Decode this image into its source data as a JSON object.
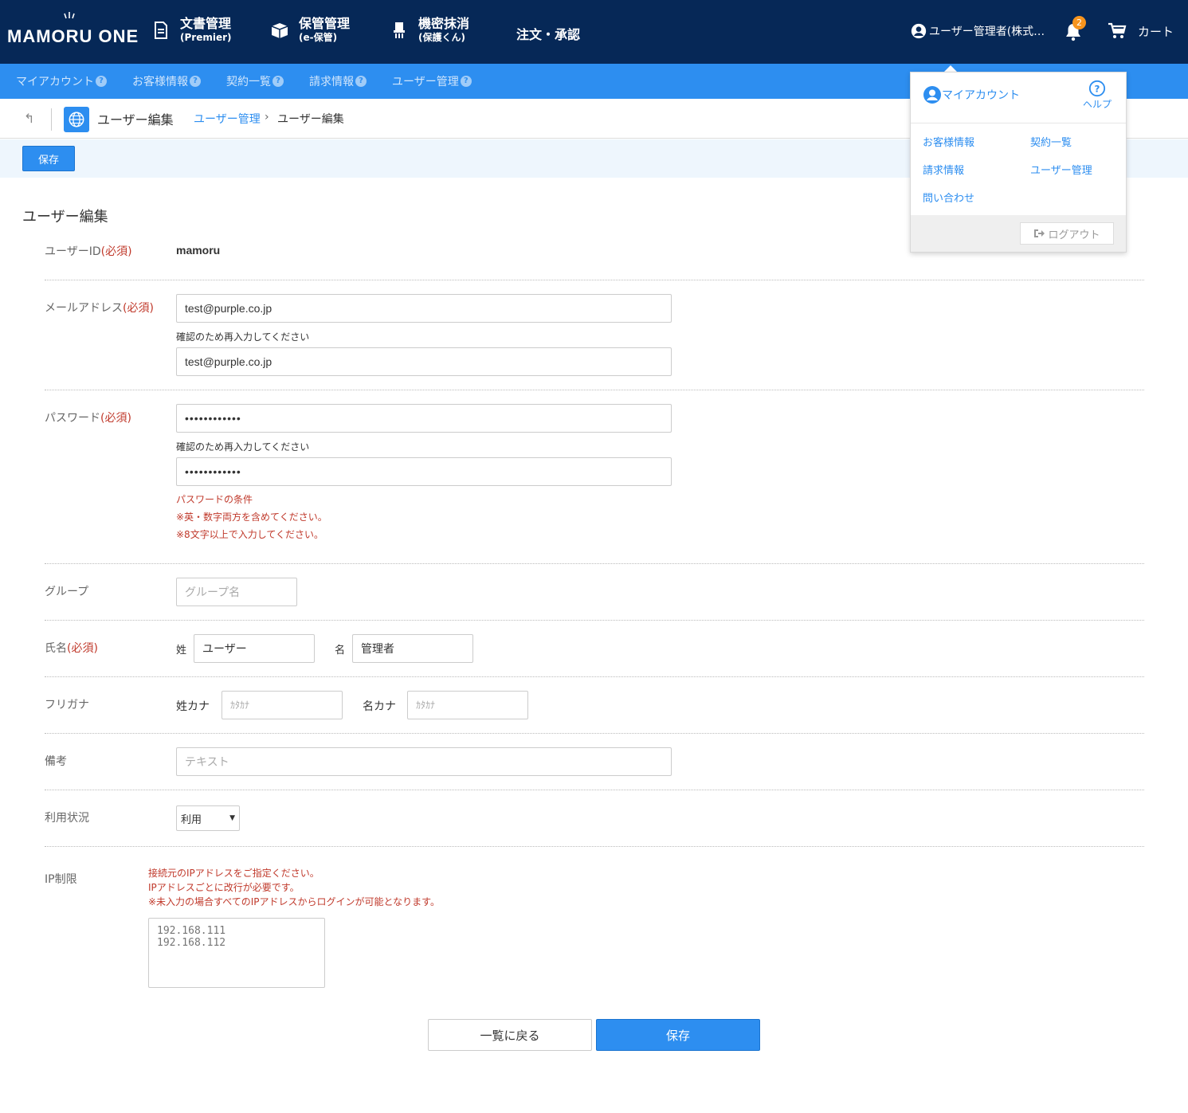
{
  "header": {
    "logo": "MAMORU ONE",
    "nav": [
      {
        "main": "文書管理",
        "sub": "(Premier)"
      },
      {
        "main": "保管管理",
        "sub": "(e-保管)"
      },
      {
        "main": "機密抹消",
        "sub": "(保護くん)"
      }
    ],
    "nav_order": "注文・承認",
    "user": "ユーザー管理者(株式…",
    "notification_count": "2",
    "cart": "カート"
  },
  "subnav": [
    "マイアカウント",
    "お客様情報",
    "契約一覧",
    "請求情報",
    "ユーザー管理"
  ],
  "breadcrumb": {
    "heading": "ユーザー編集",
    "link": "ユーザー管理",
    "separator": "›",
    "current": "ユーザー編集"
  },
  "toolbar": {
    "save_label": "保存"
  },
  "form": {
    "title": "ユーザー編集",
    "required_mark": "(必須)",
    "user_id": {
      "label": "ユーザーID",
      "value": "mamoru"
    },
    "email": {
      "label": "メールアドレス",
      "value": "test@purple.co.jp",
      "confirm_note": "確認のため再入力してください",
      "confirm_value": "test@purple.co.jp"
    },
    "password": {
      "label": "パスワード",
      "value": "••••••••••••",
      "confirm_note": "確認のため再入力してください",
      "confirm_value": "••••••••••••",
      "rules": [
        "パスワードの条件",
        "※英・数字両方を含めてください。",
        "※8文字以上で入力してください。"
      ]
    },
    "group": {
      "label": "グループ",
      "placeholder": "グループ名"
    },
    "name": {
      "label": "氏名",
      "last_label": "姓",
      "last_value": "ユーザー",
      "first_label": "名",
      "first_value": "管理者"
    },
    "furigana": {
      "label": "フリガナ",
      "last_label": "姓カナ",
      "last_placeholder": "ｶﾀｶﾅ",
      "first_label": "名カナ",
      "first_placeholder": "ｶﾀｶﾅ"
    },
    "note": {
      "label": "備考",
      "placeholder": "テキスト"
    },
    "status": {
      "label": "利用状況",
      "selected": "利用"
    },
    "ip": {
      "label": "IP制限",
      "notes": [
        "接続元のIPアドレスをご指定ください。",
        "IPアドレスごとに改行が必要です。",
        "※未入力の場合すべてのIPアドレスからログインが可能となります。"
      ],
      "placeholder": "192.168.111\n192.168.112"
    }
  },
  "buttons": {
    "back": "一覧に戻る",
    "save": "保存"
  },
  "dropdown": {
    "account": "マイアカウント",
    "help": "ヘルプ",
    "links": [
      "お客様情報",
      "契約一覧",
      "請求情報",
      "ユーザー管理",
      "問い合わせ"
    ],
    "logout": "ログアウト"
  },
  "colors": {
    "header_bg": "#062857",
    "accent": "#2d8ef0",
    "required": "#c0392b",
    "badge": "#f7941d"
  }
}
